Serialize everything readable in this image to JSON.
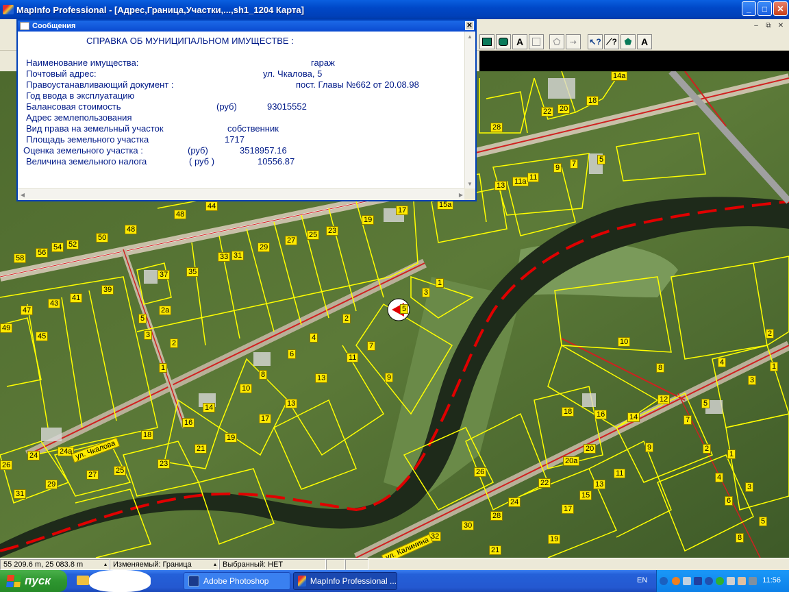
{
  "window": {
    "title": "MapInfo Professional - [Адрес,Граница,Участки,...,sh1_1204 Карта]",
    "minimize": "_",
    "maximize": "□",
    "close": "✕"
  },
  "mdi": {
    "minimize": "–",
    "restore": "⧉",
    "close": "✕"
  },
  "toolbar": {
    "text_tool": "A",
    "label_tool": "A"
  },
  "messages": {
    "title": "Сообщения",
    "close": "✕",
    "heading": "СПРАВКА ОБ МУНИЦИПАЛЬНОМ ИМУЩЕСТВЕ :",
    "rows": [
      {
        "label": "Наименование имущества:",
        "value": "гараж"
      },
      {
        "label": "Почтовый адрес:",
        "value": "ул. Чкалова, 5"
      },
      {
        "label": "Правоустанавливающий документ :",
        "value": "пост. Главы №662 от 20.08.98"
      },
      {
        "label": "Год ввода в эксплуатацию",
        "value": ""
      },
      {
        "label": "Балансовая стоимость",
        "unit": "(руб)",
        "value": "93015552"
      },
      {
        "label": "Адрес землепользования",
        "value": ""
      },
      {
        "label": "Вид права  на  земельный участок",
        "value": "собственник"
      },
      {
        "label": "Площадь земельного участка",
        "value": "1717"
      },
      {
        "label": "Оценка земельного участка  :",
        "unit": "(руб)",
        "value": "3518957.16"
      },
      {
        "label": "Величина земельного налога",
        "unit": "( руб )",
        "value": "10556.87"
      }
    ]
  },
  "map": {
    "streets": [
      "ул. Чкалова",
      "ул. Калинина"
    ],
    "parcel_labels": [
      "14а",
      "22",
      "20",
      "18",
      "28",
      "9",
      "7",
      "5",
      "13",
      "11а",
      "11",
      "15а",
      "17",
      "19",
      "44",
      "48",
      "50",
      "48",
      "52",
      "54",
      "56",
      "58",
      "29",
      "27",
      "25",
      "23",
      "33",
      "31",
      "37",
      "35",
      "39",
      "41",
      "43",
      "47",
      "2а",
      "45",
      "49",
      "3",
      "5",
      "2",
      "1",
      "4",
      "6",
      "8",
      "10",
      "2",
      "7",
      "11",
      "13",
      "9",
      "14",
      "16",
      "17",
      "18",
      "19",
      "13",
      "24",
      "24а",
      "26",
      "27",
      "25",
      "23",
      "21",
      "31",
      "29",
      "1",
      "3",
      "5",
      "10",
      "8",
      "4",
      "2",
      "1",
      "12",
      "14",
      "16",
      "18",
      "20",
      "20а",
      "9",
      "11",
      "13",
      "15",
      "17",
      "19",
      "21",
      "22",
      "24",
      "26",
      "28",
      "30",
      "32",
      "7",
      "5",
      "3",
      "2",
      "1",
      "4",
      "6",
      "8",
      "5",
      "3"
    ]
  },
  "status": {
    "coords": "55 209.6 m, 25 083.8 m",
    "editable": "Изменяемый: Граница",
    "selected": "Выбранный: НЕТ"
  },
  "taskbar": {
    "start": "пуск",
    "tasks": [
      "Adobe Photoshop",
      "MapInfo Professional ..."
    ],
    "lang": "EN",
    "clock": "11:56"
  },
  "colors": {
    "map_boundary": "#ffff00",
    "river_line": "#e00000",
    "message_text": "#001a88",
    "title_bar": "#0048c8"
  }
}
